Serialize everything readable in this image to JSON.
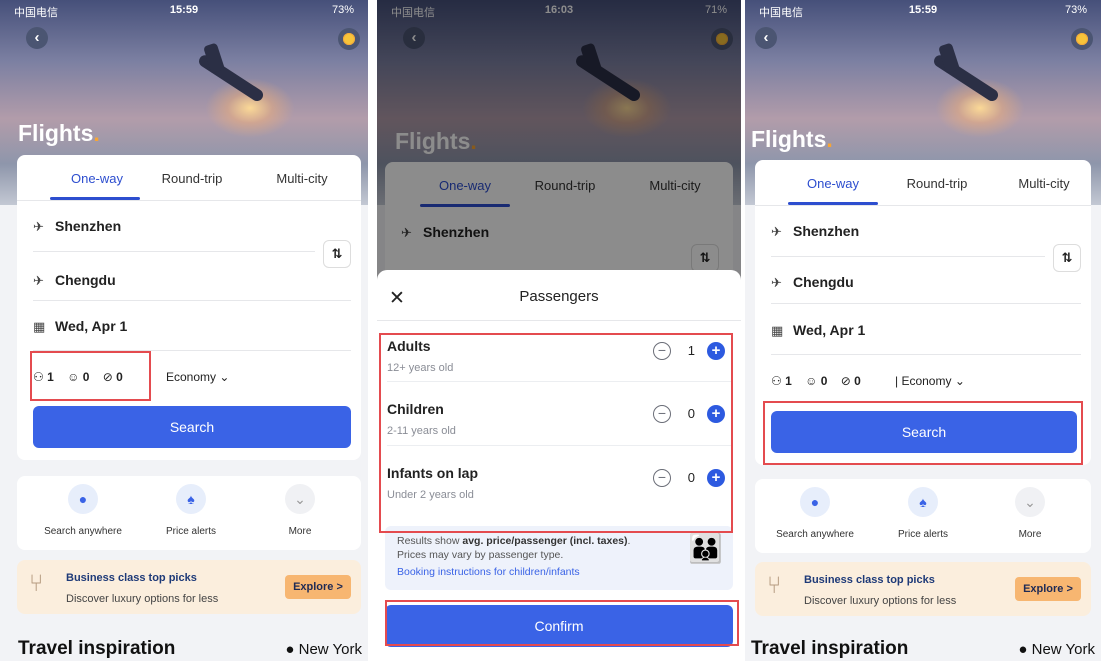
{
  "status": {
    "carrier": "中国电信",
    "panels_time": [
      "15:59",
      "16:03",
      "15:59"
    ],
    "panels_battery": [
      "73%",
      "71%",
      "73%"
    ]
  },
  "page": {
    "title": "Flights",
    "tabs": [
      "One-way",
      "Round-trip",
      "Multi-city"
    ],
    "active_tab": "One-way",
    "origin": "Shenzhen",
    "destination": "Chengdu",
    "date": "Wed, Apr 1",
    "adults": "1",
    "children": "0",
    "infants": "0",
    "cabin": "Economy",
    "search_label": "Search"
  },
  "shortcuts": [
    {
      "label": "Search anywhere",
      "icon": "globe-icon"
    },
    {
      "label": "Price alerts",
      "icon": "bell-icon"
    },
    {
      "label": "More",
      "icon": "chevron-down-icon"
    }
  ],
  "promo": {
    "title": "Business class top picks",
    "subtitle": "Discover luxury options for less",
    "cta": "Explore >"
  },
  "inspiration": {
    "title": "Travel inspiration",
    "city": "New York"
  },
  "passengers_modal": {
    "title": "Passengers",
    "rows": [
      {
        "label": "Adults",
        "desc": "12+ years old",
        "count": "1"
      },
      {
        "label": "Children",
        "desc": "2-11 years old",
        "count": "0"
      },
      {
        "label": "Infants on lap",
        "desc": "Under 2 years old",
        "count": "0"
      }
    ],
    "note_prefix": "Results show ",
    "note_bold": "avg. price/passenger (incl. taxes)",
    "note_suffix": ". Prices may vary by passenger type.",
    "note_link": "Booking instructions for children/infants",
    "confirm_label": "Confirm"
  },
  "colors": {
    "accent": "#3a63e6",
    "highlight": "#e44b4f",
    "promo_bg": "#fbeedd"
  }
}
